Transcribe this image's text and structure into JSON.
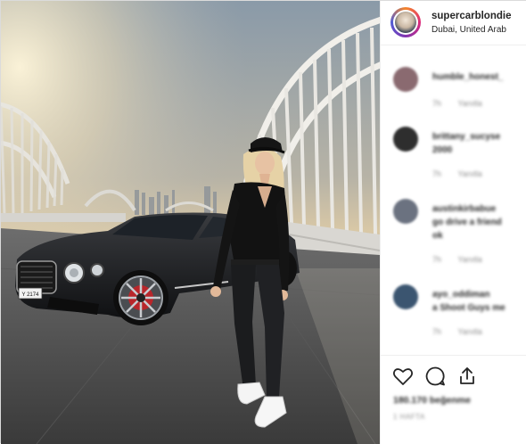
{
  "post": {
    "username": "supercarblondie",
    "location": "Dubai, United Arab"
  },
  "comments": [
    {
      "user": "humble_honest_",
      "text": "",
      "time": "7h",
      "reply": "Yanıtla",
      "avatar_color": "#8a6a70"
    },
    {
      "user": "brittany_sucyse",
      "text": "2000",
      "time": "7h",
      "reply": "Yanıtla",
      "avatar_color": "#2e2e2e"
    },
    {
      "user": "austinkirbabue",
      "text": "go drive a friend",
      "text2": "ok",
      "time": "7h",
      "reply": "Yanıtla",
      "avatar_color": "#6b7280"
    },
    {
      "user": "ayo_oddiman",
      "text": "a Shoot Guys me",
      "time": "7h",
      "reply": "Yanıtla",
      "avatar_color": "#3b5570"
    }
  ],
  "footer": {
    "likes": "180.170 beğenme",
    "time": "1 HAFTA"
  },
  "icons": {
    "like": "heart-icon",
    "comment": "speech-bubble-icon",
    "share": "share-icon"
  },
  "colors": {
    "text": "#262626",
    "muted": "#8e8e8e",
    "border": "#efefef"
  }
}
